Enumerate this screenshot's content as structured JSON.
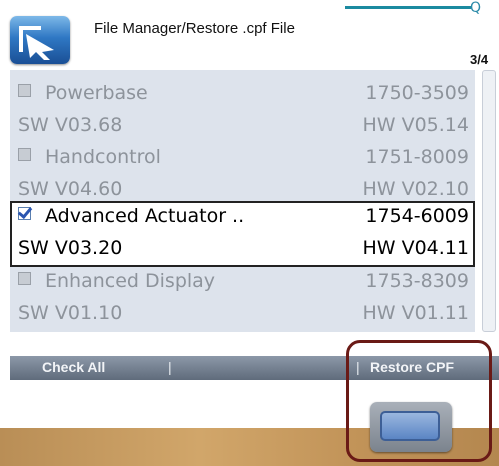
{
  "header": {
    "title": "File Manager/Restore .cpf File",
    "page_indicator": "3/4",
    "status_icon": "Q"
  },
  "devices": [
    {
      "name": "Powerbase",
      "part": "1750-3509",
      "sw": "SW V03.68",
      "hw": "HW V05.14",
      "checked": false
    },
    {
      "name": "Handcontrol",
      "part": "1751-8009",
      "sw": "SW V04.60",
      "hw": "HW V02.10",
      "checked": false
    },
    {
      "name": "Advanced Actuator ..",
      "part": "1754-6009",
      "sw": "SW V03.20",
      "hw": "HW V04.11",
      "checked": true
    },
    {
      "name": "Enhanced Display",
      "part": "1753-8309",
      "sw": "SW V01.10",
      "hw": "HW V01.11",
      "checked": false
    }
  ],
  "softkeys": {
    "left": "Check All",
    "separator": "|",
    "right": "Restore CPF"
  },
  "colors": {
    "list_bg": "#dde3ec",
    "accent": "#1b8aa0",
    "highlight": "#6a1a16"
  }
}
